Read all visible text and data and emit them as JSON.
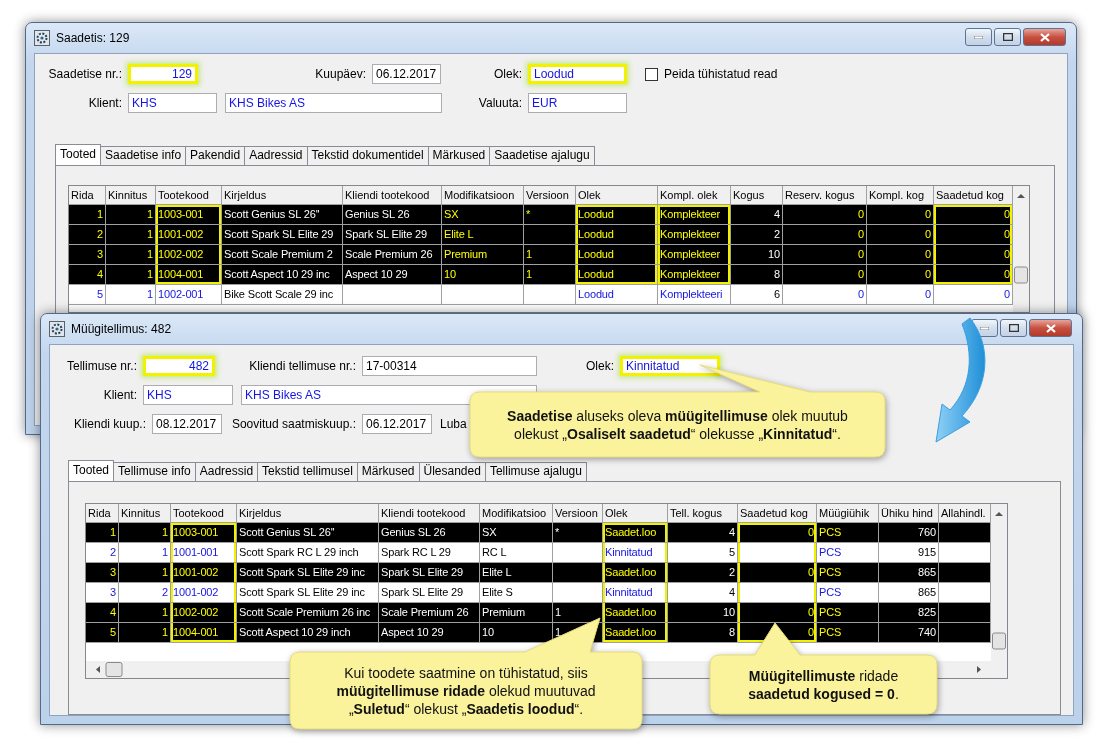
{
  "windows": [
    {
      "title": "Saadetis: 129",
      "form": [
        [
          {
            "kind": "field",
            "label": "Saadetise nr.:",
            "value": "129",
            "linked": true,
            "highlighted": true
          },
          {
            "kind": "field",
            "label": "Kuupäev:",
            "value": "06.12.2017",
            "linked": false,
            "highlighted": false
          },
          {
            "kind": "field",
            "label": "Olek:",
            "value": "Loodud",
            "linked": true,
            "highlighted": true
          },
          {
            "kind": "checkbox",
            "label": "Peida tühistatud read",
            "checked": false
          }
        ],
        [
          {
            "kind": "field",
            "label": "Klient:",
            "value": "KHS",
            "linked": true,
            "highlighted": false
          },
          {
            "kind": "field",
            "value": "KHS Bikes AS",
            "linked": true,
            "highlighted": false
          },
          {
            "kind": "field",
            "label": "Valuuta:",
            "value": "EUR",
            "linked": true,
            "highlighted": false
          }
        ]
      ],
      "tabs": [
        {
          "label": "Tooted",
          "selected": true
        },
        {
          "label": "Saadetise info",
          "selected": false
        },
        {
          "label": "Pakendid",
          "selected": false
        },
        {
          "label": "Aadressid",
          "selected": false
        },
        {
          "label": "Tekstid dokumentidel",
          "selected": false
        },
        {
          "label": "Märkused",
          "selected": false
        },
        {
          "label": "Saadetise ajalugu",
          "selected": false
        }
      ],
      "grid": {
        "columns": [
          {
            "label": "Rida",
            "linked": true,
            "highlighted": false
          },
          {
            "label": "Kinnitus",
            "linked": true,
            "highlighted": false
          },
          {
            "label": "Tootekood",
            "linked": true,
            "highlighted": true
          },
          {
            "label": "Kirjeldus",
            "linked": false,
            "highlighted": false
          },
          {
            "label": "Kliendi tootekood",
            "linked": false,
            "highlighted": false
          },
          {
            "label": "Modifikatsioon",
            "linked": true,
            "highlighted": false
          },
          {
            "label": "Versioon",
            "linked": true,
            "highlighted": false
          },
          {
            "label": "Olek",
            "linked": true,
            "highlighted": true
          },
          {
            "label": "Kompl. olek",
            "linked": true,
            "highlighted": true
          },
          {
            "label": "Kogus",
            "linked": false,
            "highlighted": false
          },
          {
            "label": "Reserv. kogus",
            "linked": true,
            "highlighted": false
          },
          {
            "label": "Kompl. kog",
            "linked": true,
            "highlighted": false
          },
          {
            "label": "Saadetud kog",
            "linked": true,
            "highlighted": true
          }
        ],
        "rows": [
          {
            "selected": true,
            "highlighted": true,
            "cells": [
              "1",
              "1",
              "1003-001",
              "Scott Genius SL 26''",
              "Genius SL 26",
              "SX",
              "*",
              "Loodud",
              "Komplekteer",
              "4",
              "0",
              "0",
              "0"
            ]
          },
          {
            "selected": true,
            "highlighted": true,
            "cells": [
              "2",
              "1",
              "1001-002",
              "Scott Spark SL Elite 29",
              "Spark SL Elite 29",
              "Elite L",
              null,
              "Loodud",
              "Komplekteer",
              "2",
              "0",
              "0",
              "0"
            ]
          },
          {
            "selected": true,
            "highlighted": true,
            "cells": [
              "3",
              "1",
              "1002-002",
              "Scott Scale Premium 2",
              "Scale Premium 26",
              "Premium",
              "1",
              "Loodud",
              "Komplekteer",
              "10",
              "0",
              "0",
              "0"
            ]
          },
          {
            "selected": true,
            "highlighted": true,
            "cells": [
              "4",
              "1",
              "1004-001",
              "Scott Aspect 10 29 inc",
              "Aspect 10 29",
              "10",
              "1",
              "Loodud",
              "Komplekteer",
              "8",
              "0",
              "0",
              "0"
            ]
          },
          {
            "selected": false,
            "highlighted": false,
            "cells": [
              "5",
              "1",
              "1002-001",
              "Bike Scott Scale 29 inc",
              null,
              null,
              null,
              "Loodud",
              "Komplekteeri",
              "6",
              "0",
              "0",
              "0"
            ]
          }
        ]
      }
    },
    {
      "title": "Müügitellimus: 482",
      "form": [
        [
          {
            "kind": "field",
            "label": "Tellimuse nr.:",
            "value": "482",
            "linked": true,
            "highlighted": true
          },
          {
            "kind": "field",
            "label": "Kliendi tellimuse nr.:",
            "value": "17-00314",
            "linked": false,
            "highlighted": false
          },
          {
            "kind": "field",
            "label": "Olek:",
            "value": "Kinnitatud",
            "linked": true,
            "highlighted": true
          }
        ],
        [
          {
            "kind": "field",
            "label": "Klient:",
            "value": "KHS",
            "linked": true,
            "highlighted": false
          },
          {
            "kind": "field",
            "value": "KHS Bikes AS",
            "linked": true,
            "highlighted": false
          }
        ],
        [
          {
            "kind": "field",
            "label": "Kliendi kuup.:",
            "value": "08.12.2017",
            "linked": false,
            "highlighted": false
          },
          {
            "kind": "field",
            "label": "Soovitud saatmiskuup.:",
            "value": "06.12.2017",
            "linked": false,
            "highlighted": false
          },
          {
            "kind": "label",
            "label": "Luba"
          }
        ]
      ],
      "tabs": [
        {
          "label": "Tooted",
          "selected": true
        },
        {
          "label": "Tellimuse info",
          "selected": false
        },
        {
          "label": "Aadressid",
          "selected": false
        },
        {
          "label": "Tekstid tellimusel",
          "selected": false
        },
        {
          "label": "Märkused",
          "selected": false
        },
        {
          "label": "Ülesanded",
          "selected": false
        },
        {
          "label": "Tellimuse ajalugu",
          "selected": false
        }
      ],
      "grid": {
        "columns": [
          {
            "label": "Rida",
            "linked": true,
            "highlighted": false
          },
          {
            "label": "Kinnitus",
            "linked": true,
            "highlighted": false
          },
          {
            "label": "Tootekood",
            "linked": true,
            "highlighted": true
          },
          {
            "label": "Kirjeldus",
            "linked": false,
            "highlighted": false
          },
          {
            "label": "Kliendi tootekood",
            "linked": false,
            "highlighted": false
          },
          {
            "label": "Modifikatsioo",
            "linked": false,
            "highlighted": false
          },
          {
            "label": "Versioon",
            "linked": false,
            "highlighted": false
          },
          {
            "label": "Olek",
            "linked": true,
            "highlighted": true
          },
          {
            "label": "Tell. kogus",
            "linked": false,
            "highlighted": false
          },
          {
            "label": "Saadetud kog",
            "linked": true,
            "highlighted": true
          },
          {
            "label": "Müügiühik",
            "linked": true,
            "highlighted": false
          },
          {
            "label": "Ühiku hind",
            "linked": false,
            "highlighted": false
          },
          {
            "label": "Allahindl.",
            "highlighted": false
          }
        ],
        "rows": [
          {
            "selected": true,
            "highlighted": true,
            "cells": [
              "1",
              "1",
              "1003-001",
              "Scott Genius SL 26''",
              "Genius SL 26",
              "SX",
              "*",
              "Saadet.loo",
              "4",
              "0",
              "PCS",
              "760",
              null
            ]
          },
          {
            "selected": false,
            "highlighted": true,
            "cells": [
              "2",
              "1",
              "1001-001",
              "Scott Spark RC L 29 inch",
              "Spark RC L 29",
              "RC L",
              null,
              "Kinnitatud",
              "5",
              null,
              "PCS",
              "915",
              null
            ]
          },
          {
            "selected": true,
            "highlighted": true,
            "cells": [
              "3",
              "1",
              "1001-002",
              "Scott Spark SL Elite 29 inc",
              "Spark SL Elite 29",
              "Elite L",
              null,
              "Saadet.loo",
              "2",
              "0",
              "PCS",
              "865",
              null
            ]
          },
          {
            "selected": false,
            "highlighted": true,
            "cells": [
              "3",
              "2",
              "1001-002",
              "Scott Spark SL Elite 29 inc",
              "Spark SL Elite 29",
              "Elite S",
              null,
              "Kinnitatud",
              "4",
              null,
              "PCS",
              "865",
              null
            ]
          },
          {
            "selected": true,
            "highlighted": true,
            "cells": [
              "4",
              "1",
              "1002-002",
              "Scott Scale Premium 26 inc",
              "Scale Premium 26",
              "Premium",
              "1",
              "Saadet.loo",
              "10",
              "0",
              "PCS",
              "825",
              null
            ]
          },
          {
            "selected": true,
            "highlighted": true,
            "cells": [
              "5",
              "1",
              "1004-001",
              "Scott Aspect 10 29 inch",
              "Aspect 10 29",
              "10",
              "1",
              "Saadet.loo",
              "8",
              "0",
              "PCS",
              "740",
              null
            ]
          }
        ]
      }
    }
  ],
  "callouts": [
    {
      "text": "**Saadetise** aluseks oleva **müügitellimuse** olek muutub olekust „**Osaliselt saadetud**“ olekusse „**Kinnitatud**“."
    },
    {
      "text": "Kui toodete saatmine on tühistatud, siis **müügitellimuse ridade** olekud muutuvad „**Suletud**“ olekust „**Saadetis loodud**“."
    },
    {
      "text": "**Müügitellimuste** ridade **saadetud kogused = 0**."
    }
  ]
}
